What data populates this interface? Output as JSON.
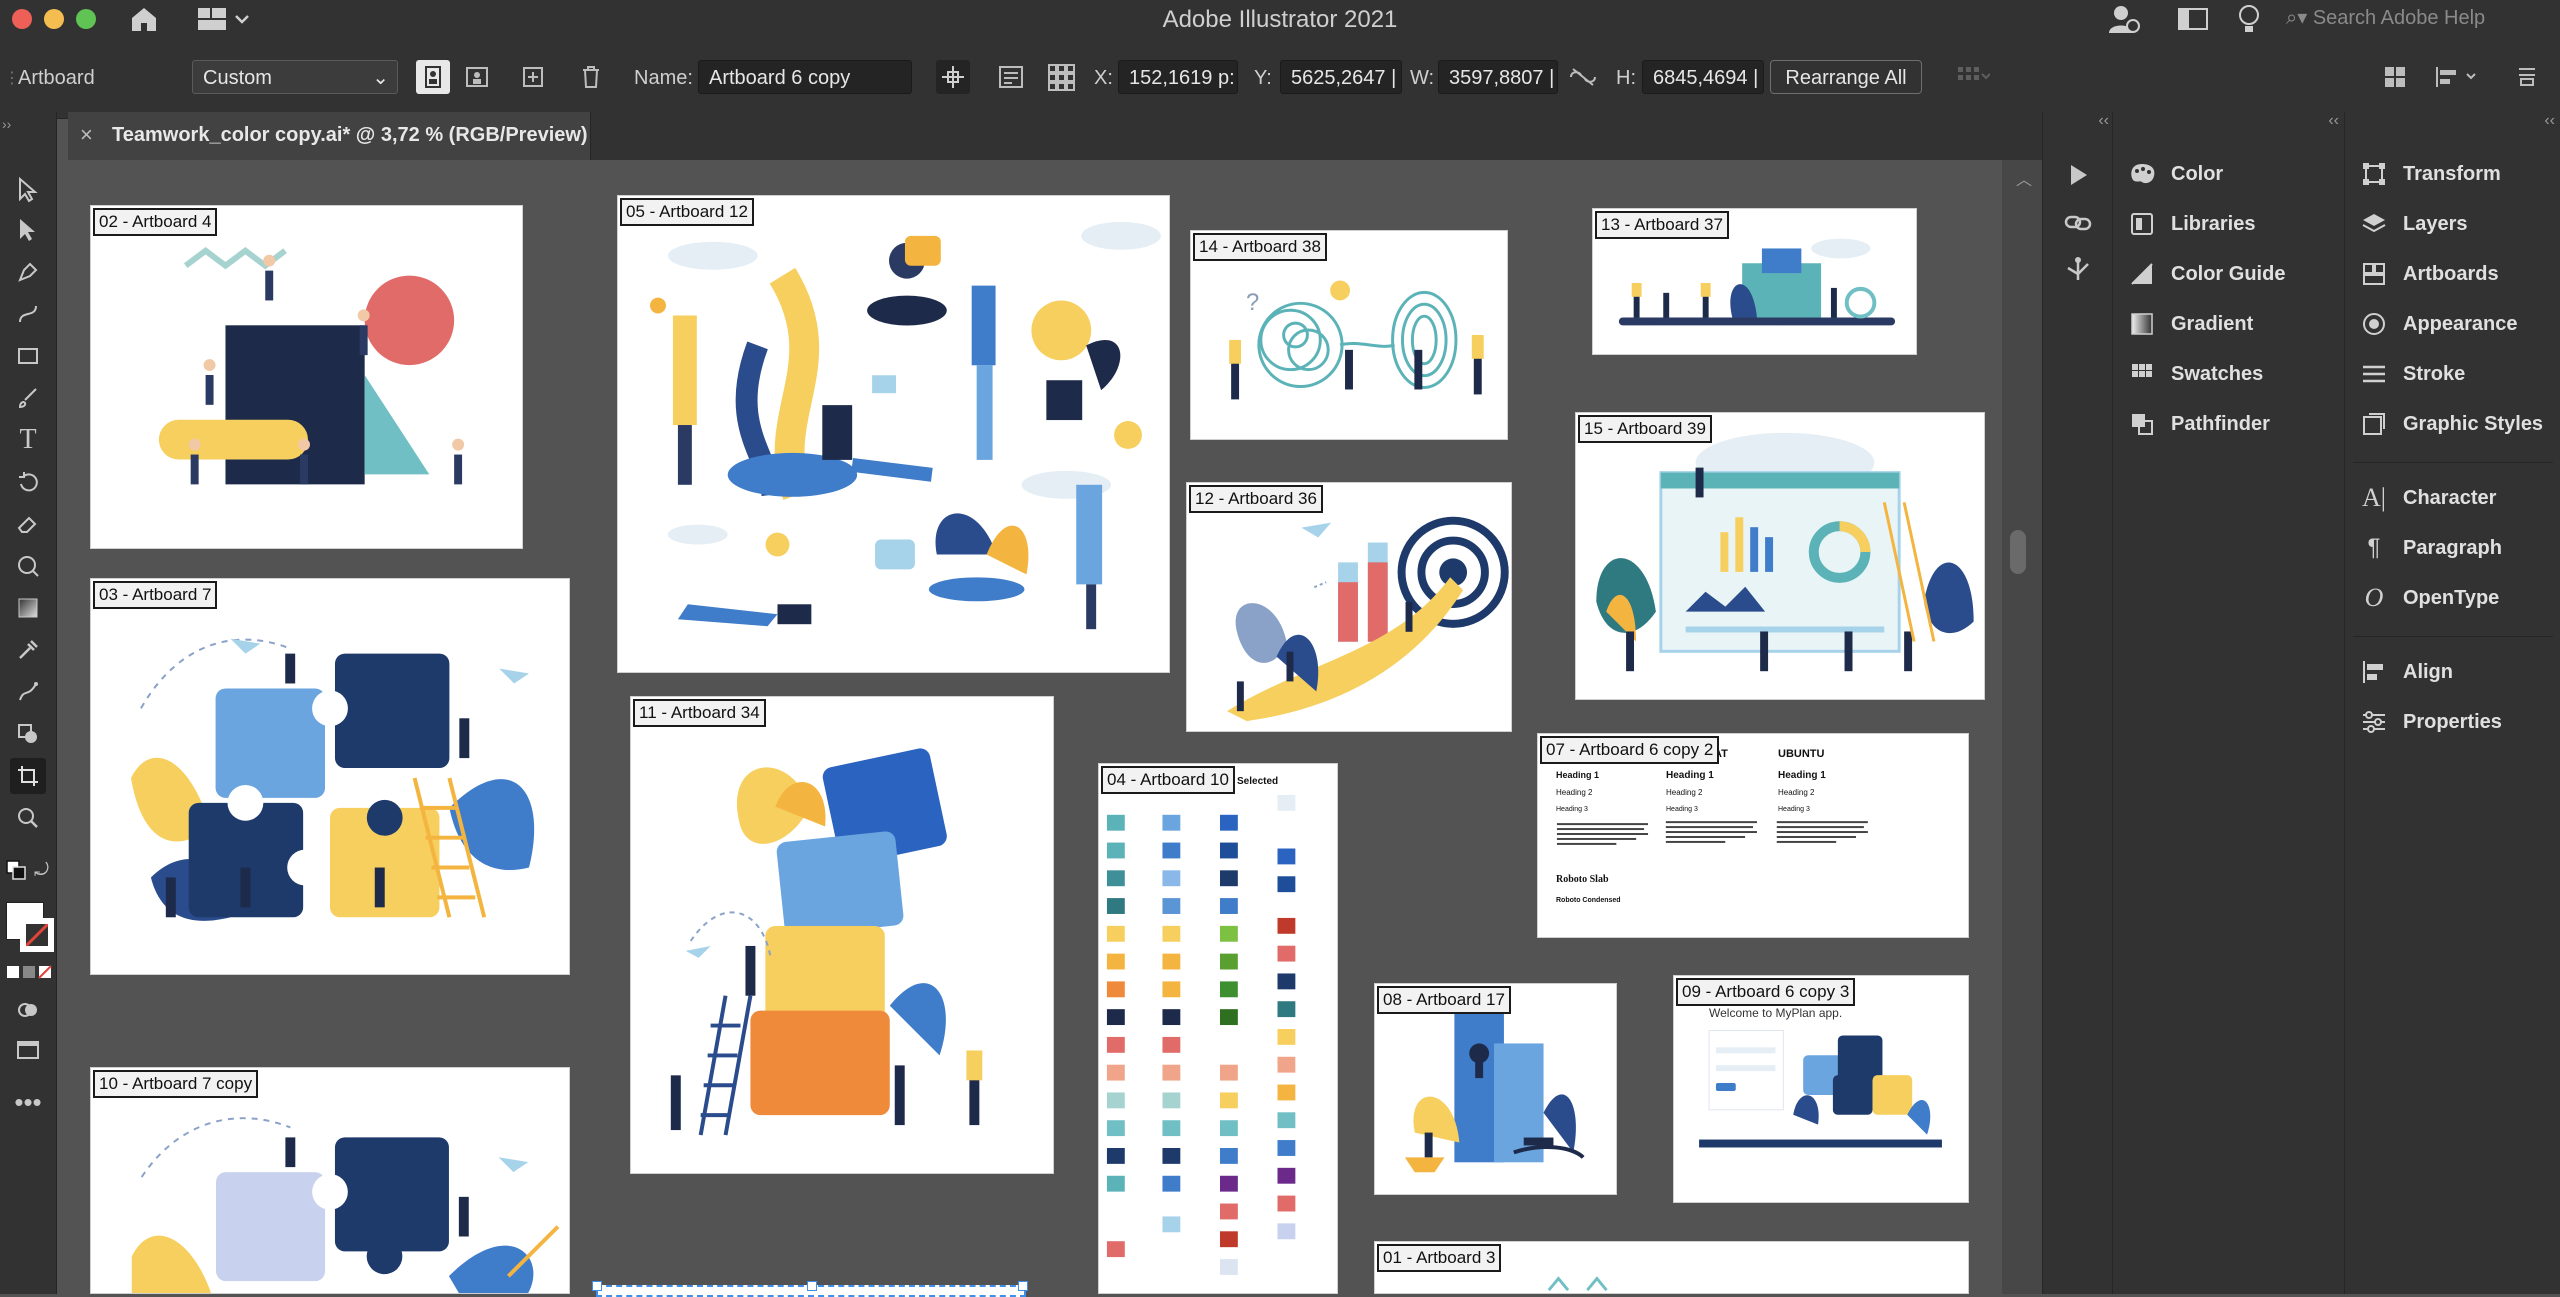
{
  "app": {
    "title": "Adobe Illustrator 2021",
    "search_placeholder": "Search Adobe Help"
  },
  "control_bar": {
    "mode": "Artboard",
    "preset": "Custom",
    "name_label": "Name:",
    "name_value": "Artboard 6 copy",
    "x_label": "X:",
    "x_value": "152,1619 p:",
    "y_label": "Y:",
    "y_value": "5625,2647 |",
    "w_label": "W:",
    "w_value": "3597,8807 |",
    "h_label": "H:",
    "h_value": "6845,4694 |",
    "rearrange_label": "Rearrange All"
  },
  "document_tab": {
    "label": "Teamwork_color copy.ai* @ 3,72 % (RGB/Preview)"
  },
  "artboards": [
    {
      "label": "02 - Artboard 4"
    },
    {
      "label": "05 - Artboard 12"
    },
    {
      "label": "14 - Artboard 38"
    },
    {
      "label": "13 - Artboard 37"
    },
    {
      "label": "03 - Artboard 7"
    },
    {
      "label": "12 - Artboard 36"
    },
    {
      "label": "15 - Artboard 39"
    },
    {
      "label": "11 - Artboard 34"
    },
    {
      "label": "04 - Artboard 10"
    },
    {
      "label": "07 - Artboard 6 copy 2"
    },
    {
      "label": "08 - Artboard 17"
    },
    {
      "label": "09 - Artboard 6 copy 3"
    },
    {
      "label": "10 - Artboard 7 copy"
    },
    {
      "label": "01 - Artboard 3"
    }
  ],
  "artboard_text": {
    "selected": "Selected",
    "font_a": "RAT",
    "font_b": "UBUNTU",
    "h1": "Heading 1",
    "h2": "Heading 2",
    "h3": "Heading 3",
    "roboto_slab": "Roboto Slab",
    "roboto_condensed": "Roboto Condensed",
    "myplan": "Welcome to MyPlan app."
  },
  "panels": {
    "col1": [
      "Color",
      "Libraries",
      "Color Guide",
      "Gradient",
      "Swatches",
      "Pathfinder"
    ],
    "col2_a": [
      "Transform",
      "Layers",
      "Artboards",
      "Appearance",
      "Stroke",
      "Graphic Styles"
    ],
    "col2_b": [
      "Character",
      "Paragraph",
      "OpenType"
    ],
    "col2_c": [
      "Align",
      "Properties"
    ]
  },
  "colors": {
    "ui_dark": "#323232",
    "canvas": "#535353",
    "navy": "#1e2a4a",
    "blue": "#3f7cc9",
    "yellow": "#f7cf5e",
    "teal": "#6fbfc4",
    "coral": "#e06b68",
    "orange": "#ee8a3a"
  }
}
